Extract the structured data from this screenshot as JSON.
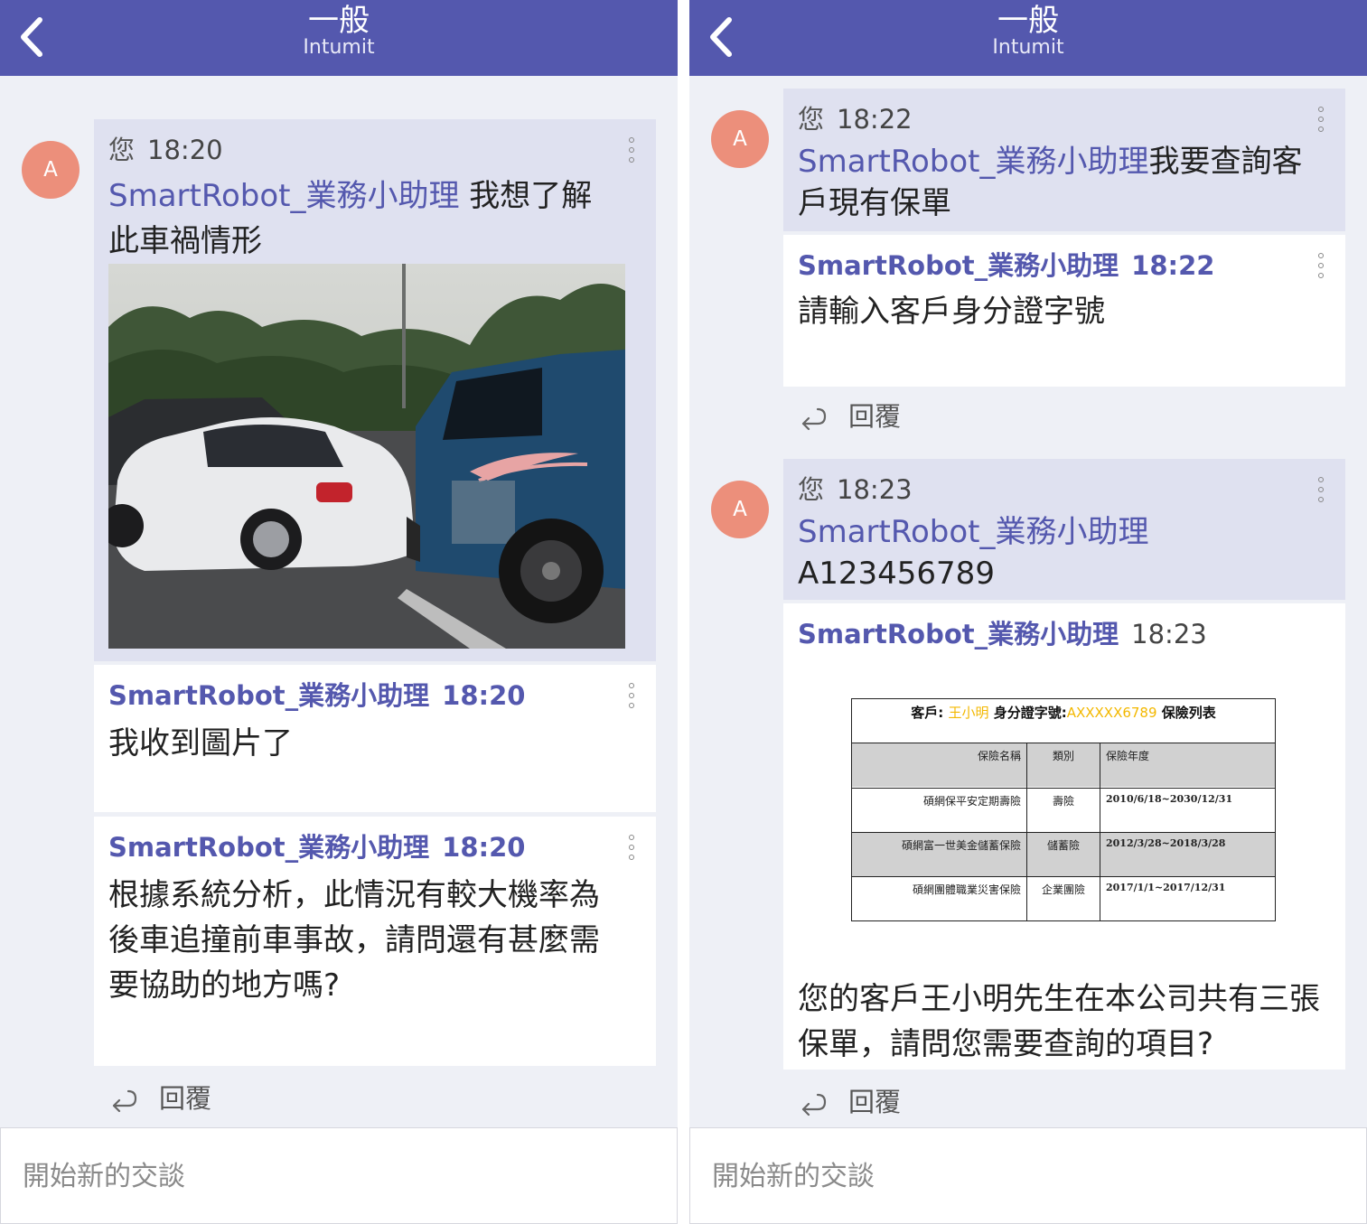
{
  "header": {
    "title": "一般",
    "subtitle": "Intumit"
  },
  "composer": {
    "placeholder": "開始新的交談"
  },
  "left": {
    "user_msg": {
      "avatar": "A",
      "sender": "您",
      "time": "18:20",
      "mention": "SmartRobot_業務小助理",
      "text": " 我想了解此車禍情形",
      "image": "car-accident-photo"
    },
    "bot_msg_1": {
      "sender": "SmartRobot_業務小助理",
      "time": "18:20",
      "text": "我收到圖片了"
    },
    "bot_msg_2": {
      "sender": "SmartRobot_業務小助理",
      "time": "18:20",
      "text": "根據系統分析，此情況有較大機率為後車追撞前車事故，請問還有甚麼需要協助的地方嗎?"
    },
    "reply_label": "回覆"
  },
  "right": {
    "user_msg_1": {
      "avatar": "A",
      "sender": "您",
      "time": "18:22",
      "mention": "SmartRobot_業務小助理",
      "text": "我要查詢客戶現有保單"
    },
    "bot_msg_1": {
      "sender": "SmartRobot_業務小助理",
      "time": "18:22",
      "text": "請輸入客戶身分證字號"
    },
    "reply_label_1": "回覆",
    "user_msg_2": {
      "avatar": "A",
      "sender": "您",
      "time": "18:23",
      "mention": "SmartRobot_業務小助理",
      "text": "A123456789"
    },
    "bot_msg_2": {
      "sender": "SmartRobot_業務小助理",
      "time": "18:23",
      "table": {
        "title_prefix": "客戶:",
        "client_name": "王小明",
        "id_label": "身分證字號:",
        "id_value": "AXXXXX6789",
        "title_suffix": "保險列表",
        "headers": [
          "保險名稱",
          "類別",
          "保險年度"
        ],
        "rows": [
          [
            "碩網保平安定期壽險",
            "壽險",
            "2010/6/18~2030/12/31"
          ],
          [
            "碩網富一世美金儲蓄保險",
            "儲蓄險",
            "2012/3/28~2018/3/28"
          ],
          [
            "碩網團體職業災害保險",
            "企業團險",
            "2017/1/1~2017/12/31"
          ]
        ]
      },
      "text": "您的客戶王小明先生在本公司共有三張保單，請問您需要查詢的項目?"
    },
    "reply_label_2": "回覆"
  },
  "colors": {
    "header": "#5458ae",
    "accent": "#5458ae",
    "avatar": "#ec8f7b",
    "highlight": "#f3b800",
    "own_bubble": "#dfe1f0"
  }
}
